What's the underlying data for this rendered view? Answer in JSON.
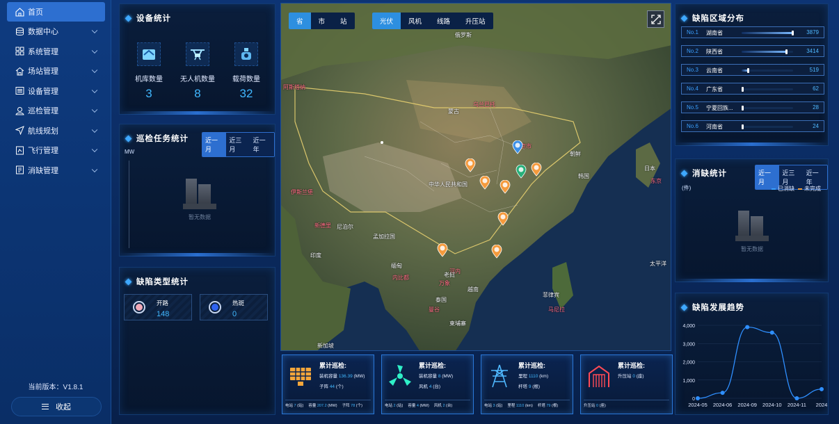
{
  "sidebar": {
    "items": [
      {
        "label": "首页",
        "icon": "home-icon",
        "active": true
      },
      {
        "label": "数据中心",
        "icon": "database-icon"
      },
      {
        "label": "系统管理",
        "icon": "grid-icon"
      },
      {
        "label": "场站管理",
        "icon": "station-icon"
      },
      {
        "label": "设备管理",
        "icon": "list-icon"
      },
      {
        "label": "巡检管理",
        "icon": "user-location-icon"
      },
      {
        "label": "航线规划",
        "icon": "navigation-icon"
      },
      {
        "label": "飞行管理",
        "icon": "flight-doc-icon"
      },
      {
        "label": "消缺管理",
        "icon": "checklist-icon"
      }
    ],
    "version": "当前版本：V1.8.1",
    "collapse_label": "收起"
  },
  "device_stats": {
    "title": "设备统计",
    "items": [
      {
        "label": "机库数量",
        "value": "3",
        "icon": "hangar-icon"
      },
      {
        "label": "无人机数量",
        "value": "8",
        "icon": "drone-icon"
      },
      {
        "label": "载荷数量",
        "value": "32",
        "icon": "payload-icon"
      }
    ]
  },
  "inspection_tasks": {
    "title": "巡检任务统计",
    "ranges": [
      "近一月",
      "近三月",
      "近一年"
    ],
    "unit": "MW",
    "empty": "暂无数据"
  },
  "defect_types": {
    "title": "缺陷类型统计",
    "items": [
      {
        "label": "开路",
        "value": "148",
        "color": "#f2aab8"
      },
      {
        "label": "热斑",
        "value": "0",
        "color": "#2f63f0"
      }
    ]
  },
  "map": {
    "level_tabs": [
      "省",
      "市",
      "站"
    ],
    "type_tabs": [
      "光伏",
      "风机",
      "线路",
      "升压站"
    ],
    "labels": [
      {
        "text": "俄罗斯",
        "red": false
      },
      {
        "text": "蒙古",
        "red": false
      },
      {
        "text": "乌兰巴托",
        "red": true
      },
      {
        "text": "中华人民共和国",
        "red": false
      },
      {
        "text": "北京市",
        "red": true
      },
      {
        "text": "朝鲜",
        "red": false
      },
      {
        "text": "韩国",
        "red": false
      },
      {
        "text": "日本",
        "red": false
      },
      {
        "text": "东京",
        "red": true
      },
      {
        "text": "阿斯塔纳",
        "red": true
      },
      {
        "text": "伊斯兰堡",
        "red": true
      },
      {
        "text": "新德里",
        "red": true
      },
      {
        "text": "尼泊尔",
        "red": false
      },
      {
        "text": "印度",
        "red": false
      },
      {
        "text": "孟加拉国",
        "red": false
      },
      {
        "text": "缅甸",
        "red": false
      },
      {
        "text": "内比都",
        "red": true
      },
      {
        "text": "河内",
        "red": true
      },
      {
        "text": "万象",
        "red": true
      },
      {
        "text": "老挝",
        "red": false
      },
      {
        "text": "越南",
        "red": false
      },
      {
        "text": "泰国",
        "red": false
      },
      {
        "text": "曼谷",
        "red": true
      },
      {
        "text": "柬埔寨",
        "red": false
      },
      {
        "text": "菲律宾",
        "red": false
      },
      {
        "text": "马尼拉",
        "red": true
      },
      {
        "text": "太平洋",
        "red": false
      },
      {
        "text": "新加坡",
        "red": false
      }
    ]
  },
  "summary_cards": [
    {
      "title": "累计巡检:",
      "icon": "solar-panel-icon",
      "line1_label": "装机容量",
      "line1_value": "136.39",
      "line1_unit": "(MW)",
      "line2_label": "子阵",
      "line2_value": "44",
      "line2_unit": "(个)",
      "foot": [
        [
          "电站",
          "7",
          "(站)"
        ],
        [
          "容量",
          "207.2",
          "(MW)"
        ],
        [
          "子阵",
          "78",
          "(个)"
        ]
      ]
    },
    {
      "title": "累计巡检:",
      "icon": "wind-turbine-icon",
      "line1_label": "装机容量",
      "line1_value": "8",
      "line1_unit": "(MW)",
      "line2_label": "风机",
      "line2_value": "4",
      "line2_unit": "(台)",
      "foot": [
        [
          "电站",
          "2",
          "(站)"
        ],
        [
          "容量",
          "4",
          "(MW)"
        ],
        [
          "风机",
          "2",
          "(台)"
        ]
      ]
    },
    {
      "title": "累计巡检:",
      "icon": "power-tower-icon",
      "line1_label": "里程",
      "line1_value": "1110",
      "line1_unit": "(km)",
      "line2_label": "杆塔",
      "line2_value": "9",
      "line2_unit": "(根)",
      "foot": [
        [
          "电站",
          "3",
          "(站)"
        ],
        [
          "里程",
          "1110",
          "(km)"
        ],
        [
          "杆塔",
          "79",
          "(根)"
        ]
      ]
    },
    {
      "title": "累计巡检:",
      "icon": "substation-icon",
      "line1_label": "升压站",
      "line1_value": "0",
      "line1_unit": "(座)",
      "line2_label": "",
      "line2_value": "",
      "line2_unit": "",
      "foot": [
        [
          "升压站",
          "0",
          "(座)"
        ]
      ]
    }
  ],
  "region_distribution": {
    "title": "缺陷区域分布",
    "rows": [
      {
        "rank": "No.1",
        "province": "湖南省",
        "value": 3879
      },
      {
        "rank": "No.2",
        "province": "陕西省",
        "value": 3414
      },
      {
        "rank": "No.3",
        "province": "云南省",
        "value": 519
      },
      {
        "rank": "No.4",
        "province": "广东省",
        "value": 62
      },
      {
        "rank": "No.5",
        "province": "宁夏回族...",
        "value": 28
      },
      {
        "rank": "No.6",
        "province": "河南省",
        "value": 24
      }
    ]
  },
  "elimination": {
    "title": "消缺统计",
    "ranges": [
      "近一月",
      "近三月",
      "近一年"
    ],
    "unit": "(件)",
    "legend": [
      {
        "label": "已消缺",
        "color": "#3aa0ff"
      },
      {
        "label": "未完成",
        "color": "#f0a040"
      }
    ],
    "empty": "暂无数据"
  },
  "trend": {
    "title": "缺陷发展趋势",
    "y_ticks": [
      "4,000",
      "3,000",
      "2,000",
      "1,000",
      "0"
    ]
  },
  "chart_data": {
    "type": "line",
    "x": [
      "2024-05",
      "2024-06",
      "2024-09",
      "2024-10",
      "2024-11",
      "2024"
    ],
    "values": [
      0,
      300,
      3900,
      3600,
      0,
      500
    ],
    "ylim": [
      0,
      4000
    ],
    "color": "#2f8fff"
  }
}
